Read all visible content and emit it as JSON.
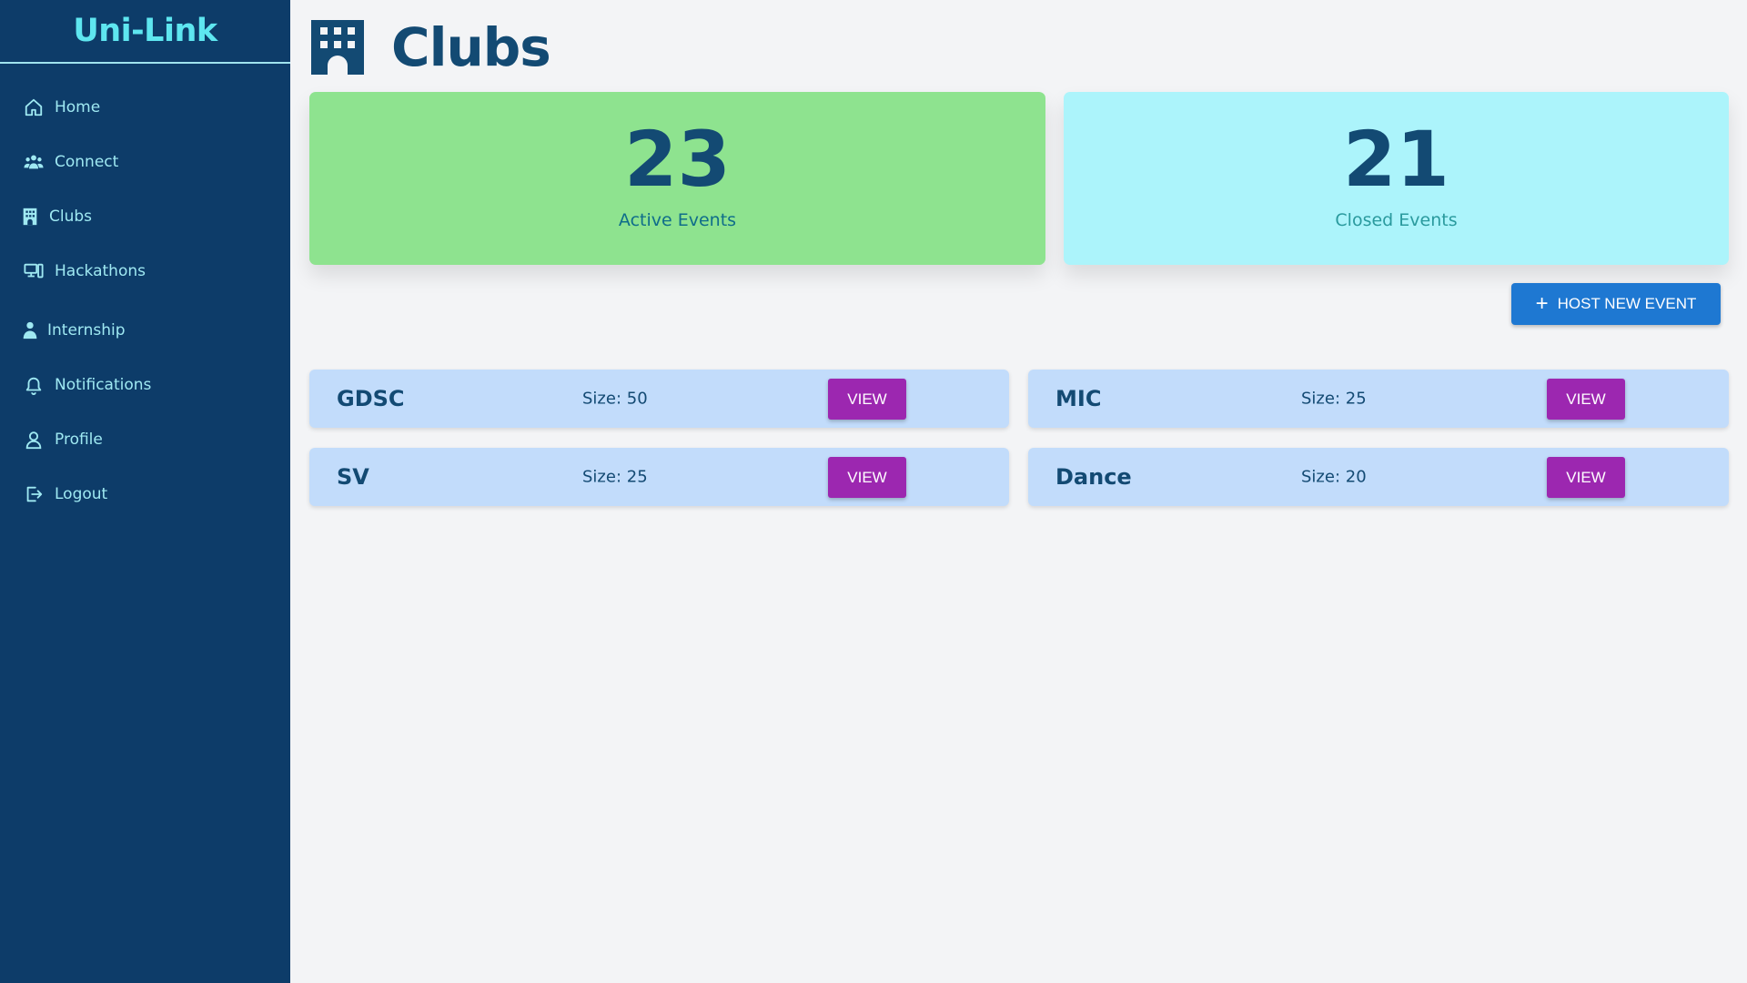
{
  "app": {
    "brand": "Uni-Link"
  },
  "sidebar": {
    "items": [
      {
        "label": "Home",
        "icon": "home-icon"
      },
      {
        "label": "Connect",
        "icon": "users-icon"
      },
      {
        "label": "Clubs",
        "icon": "building-icon"
      },
      {
        "label": "Hackathons",
        "icon": "devices-icon"
      },
      {
        "label": "Internship",
        "icon": "person-icon"
      },
      {
        "label": "Notifications",
        "icon": "bell-icon"
      },
      {
        "label": "Profile",
        "icon": "user-icon"
      },
      {
        "label": "Logout",
        "icon": "logout-icon"
      }
    ]
  },
  "header": {
    "title": "Clubs",
    "icon": "building-icon"
  },
  "stats": {
    "active": {
      "value": "23",
      "label": "Active Events",
      "color": "#8ee38f"
    },
    "closed": {
      "value": "21",
      "label": "Closed Events",
      "color": "#acf4fb"
    }
  },
  "actions": {
    "host_label": "HOST NEW EVENT"
  },
  "clubs": [
    {
      "name": "GDSC",
      "size": "Size: 50",
      "view_label": "VIEW"
    },
    {
      "name": "MIC",
      "size": "Size: 25",
      "view_label": "VIEW"
    },
    {
      "name": "SV",
      "size": "Size: 25",
      "view_label": "VIEW"
    },
    {
      "name": "Dance",
      "size": "Size: 20",
      "view_label": "VIEW"
    }
  ],
  "colors": {
    "sidebar": "#0d3c69",
    "brand": "#5ee6f0",
    "nav_text": "#9fe9f2",
    "primary_button": "#1e78d2",
    "view_button": "#9c27b0",
    "club_card": "#c2dcfb",
    "heading": "#134a73"
  }
}
